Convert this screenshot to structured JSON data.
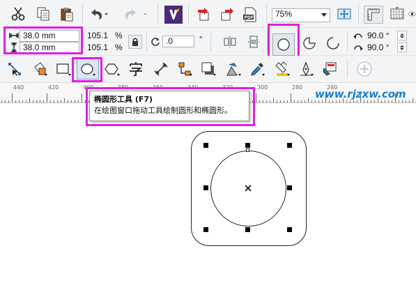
{
  "toolbar_standard": {
    "icons": [
      "scissors-icon",
      "copy-icon",
      "paste-icon",
      "undo-icon",
      "redo-icon",
      "app-launcher-icon",
      "import-icon",
      "export-icon",
      "publish-pdf-icon",
      "full-screen-preview-icon",
      "rulers-icon",
      "grid-icon",
      "view-icon"
    ],
    "zoom_level": "75%"
  },
  "property_bar": {
    "width_value": "38.0 mm",
    "height_value": "38.0 mm",
    "scale_x": "105.1",
    "scale_y": "105.1",
    "percent_symbol": "%",
    "rotation_value": ".0",
    "degree_symbol": "°",
    "start_angle": "90.0 °",
    "end_angle": "90.0 °"
  },
  "toolbox": {
    "tools": [
      "shape-tool",
      "smart-fill-tool",
      "rectangle-tool",
      "ellipse-tool",
      "polygon-tool",
      "text-tool",
      "parallel-dimension-tool",
      "connector-tool",
      "drop-shadow-tool",
      "transparency-tool",
      "color-eyedropper-tool",
      "interactive-fill-tool",
      "smart-drawing-tool",
      "edit-fill-tool",
      "add-tool"
    ]
  },
  "ruler": {
    "labels": [
      "440",
      "420",
      "400",
      "380",
      "360",
      "340",
      "320",
      "300",
      "280",
      "260"
    ]
  },
  "tooltip": {
    "title": "椭圆形工具 (F7)",
    "description": "在绘图窗口拖动工具绘制圆形和椭圆形。"
  },
  "watermark": "www.rjzxw.com",
  "colors": {
    "highlight": "#e11de3",
    "watermark": "#1a7fd4",
    "toolbar_bg": "#f3f4f6"
  }
}
